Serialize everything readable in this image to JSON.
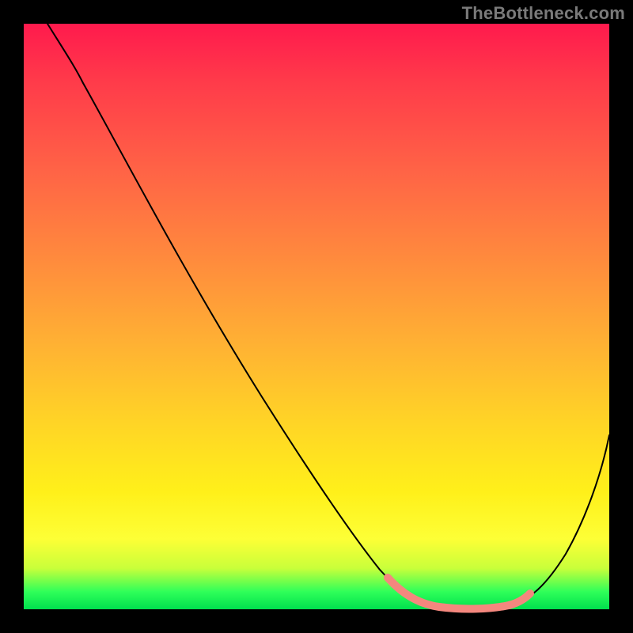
{
  "watermark": "TheBottleneck.com",
  "colors": {
    "background": "#000000",
    "gradient_top": "#ff1a4d",
    "gradient_bottom": "#00e04e",
    "curve": "#000000",
    "highlight": "#f4877e"
  },
  "chart_data": {
    "type": "line",
    "title": "",
    "xlabel": "",
    "ylabel": "",
    "xlim": [
      0,
      100
    ],
    "ylim": [
      0,
      100
    ],
    "x": [
      0,
      5,
      10,
      20,
      30,
      40,
      50,
      58,
      62,
      66,
      70,
      74,
      78,
      82,
      86,
      90,
      95,
      100
    ],
    "values": [
      100,
      97,
      93,
      80,
      66,
      52,
      38,
      24,
      14,
      7,
      2,
      0,
      0,
      0,
      2,
      8,
      20,
      35
    ],
    "highlight_range_x": [
      62,
      84
    ],
    "annotations": []
  }
}
